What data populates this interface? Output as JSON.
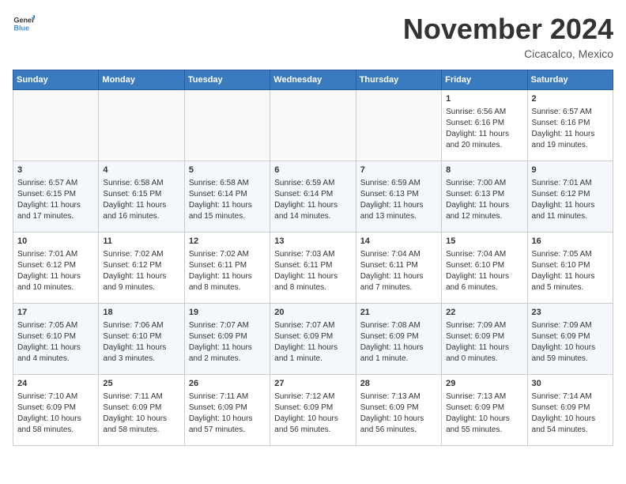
{
  "header": {
    "logo_line1": "General",
    "logo_line2": "Blue",
    "month": "November 2024",
    "location": "Cicacalco, Mexico"
  },
  "weekdays": [
    "Sunday",
    "Monday",
    "Tuesday",
    "Wednesday",
    "Thursday",
    "Friday",
    "Saturday"
  ],
  "weeks": [
    [
      {
        "day": "",
        "info": ""
      },
      {
        "day": "",
        "info": ""
      },
      {
        "day": "",
        "info": ""
      },
      {
        "day": "",
        "info": ""
      },
      {
        "day": "",
        "info": ""
      },
      {
        "day": "1",
        "info": "Sunrise: 6:56 AM\nSunset: 6:16 PM\nDaylight: 11 hours\nand 20 minutes."
      },
      {
        "day": "2",
        "info": "Sunrise: 6:57 AM\nSunset: 6:16 PM\nDaylight: 11 hours\nand 19 minutes."
      }
    ],
    [
      {
        "day": "3",
        "info": "Sunrise: 6:57 AM\nSunset: 6:15 PM\nDaylight: 11 hours\nand 17 minutes."
      },
      {
        "day": "4",
        "info": "Sunrise: 6:58 AM\nSunset: 6:15 PM\nDaylight: 11 hours\nand 16 minutes."
      },
      {
        "day": "5",
        "info": "Sunrise: 6:58 AM\nSunset: 6:14 PM\nDaylight: 11 hours\nand 15 minutes."
      },
      {
        "day": "6",
        "info": "Sunrise: 6:59 AM\nSunset: 6:14 PM\nDaylight: 11 hours\nand 14 minutes."
      },
      {
        "day": "7",
        "info": "Sunrise: 6:59 AM\nSunset: 6:13 PM\nDaylight: 11 hours\nand 13 minutes."
      },
      {
        "day": "8",
        "info": "Sunrise: 7:00 AM\nSunset: 6:13 PM\nDaylight: 11 hours\nand 12 minutes."
      },
      {
        "day": "9",
        "info": "Sunrise: 7:01 AM\nSunset: 6:12 PM\nDaylight: 11 hours\nand 11 minutes."
      }
    ],
    [
      {
        "day": "10",
        "info": "Sunrise: 7:01 AM\nSunset: 6:12 PM\nDaylight: 11 hours\nand 10 minutes."
      },
      {
        "day": "11",
        "info": "Sunrise: 7:02 AM\nSunset: 6:12 PM\nDaylight: 11 hours\nand 9 minutes."
      },
      {
        "day": "12",
        "info": "Sunrise: 7:02 AM\nSunset: 6:11 PM\nDaylight: 11 hours\nand 8 minutes."
      },
      {
        "day": "13",
        "info": "Sunrise: 7:03 AM\nSunset: 6:11 PM\nDaylight: 11 hours\nand 8 minutes."
      },
      {
        "day": "14",
        "info": "Sunrise: 7:04 AM\nSunset: 6:11 PM\nDaylight: 11 hours\nand 7 minutes."
      },
      {
        "day": "15",
        "info": "Sunrise: 7:04 AM\nSunset: 6:10 PM\nDaylight: 11 hours\nand 6 minutes."
      },
      {
        "day": "16",
        "info": "Sunrise: 7:05 AM\nSunset: 6:10 PM\nDaylight: 11 hours\nand 5 minutes."
      }
    ],
    [
      {
        "day": "17",
        "info": "Sunrise: 7:05 AM\nSunset: 6:10 PM\nDaylight: 11 hours\nand 4 minutes."
      },
      {
        "day": "18",
        "info": "Sunrise: 7:06 AM\nSunset: 6:10 PM\nDaylight: 11 hours\nand 3 minutes."
      },
      {
        "day": "19",
        "info": "Sunrise: 7:07 AM\nSunset: 6:09 PM\nDaylight: 11 hours\nand 2 minutes."
      },
      {
        "day": "20",
        "info": "Sunrise: 7:07 AM\nSunset: 6:09 PM\nDaylight: 11 hours\nand 1 minute."
      },
      {
        "day": "21",
        "info": "Sunrise: 7:08 AM\nSunset: 6:09 PM\nDaylight: 11 hours\nand 1 minute."
      },
      {
        "day": "22",
        "info": "Sunrise: 7:09 AM\nSunset: 6:09 PM\nDaylight: 11 hours\nand 0 minutes."
      },
      {
        "day": "23",
        "info": "Sunrise: 7:09 AM\nSunset: 6:09 PM\nDaylight: 10 hours\nand 59 minutes."
      }
    ],
    [
      {
        "day": "24",
        "info": "Sunrise: 7:10 AM\nSunset: 6:09 PM\nDaylight: 10 hours\nand 58 minutes."
      },
      {
        "day": "25",
        "info": "Sunrise: 7:11 AM\nSunset: 6:09 PM\nDaylight: 10 hours\nand 58 minutes."
      },
      {
        "day": "26",
        "info": "Sunrise: 7:11 AM\nSunset: 6:09 PM\nDaylight: 10 hours\nand 57 minutes."
      },
      {
        "day": "27",
        "info": "Sunrise: 7:12 AM\nSunset: 6:09 PM\nDaylight: 10 hours\nand 56 minutes."
      },
      {
        "day": "28",
        "info": "Sunrise: 7:13 AM\nSunset: 6:09 PM\nDaylight: 10 hours\nand 56 minutes."
      },
      {
        "day": "29",
        "info": "Sunrise: 7:13 AM\nSunset: 6:09 PM\nDaylight: 10 hours\nand 55 minutes."
      },
      {
        "day": "30",
        "info": "Sunrise: 7:14 AM\nSunset: 6:09 PM\nDaylight: 10 hours\nand 54 minutes."
      }
    ]
  ]
}
